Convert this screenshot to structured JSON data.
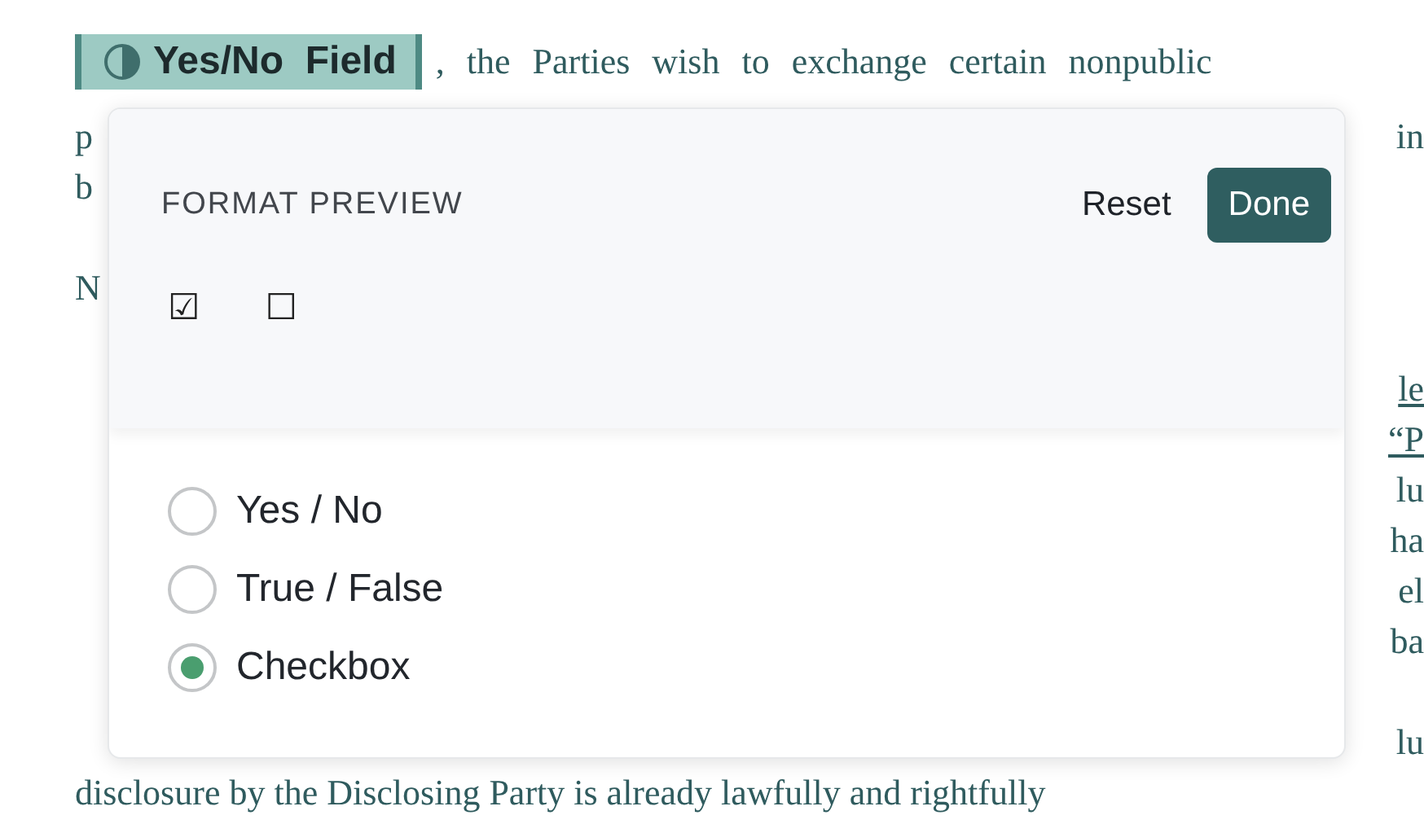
{
  "document": {
    "field": {
      "label": "Yes/No  Field"
    },
    "lines": [
      {
        "kind": "text",
        "left": ", the Parties wish to exchange certain nonpublic"
      },
      {
        "kind": "text",
        "left": "p",
        "right": "in"
      },
      {
        "kind": "text",
        "left": "b"
      },
      {
        "kind": "blank"
      },
      {
        "kind": "text",
        "left": "N"
      },
      {
        "kind": "blank"
      },
      {
        "kind": "text",
        "right": "le",
        "underlined": true
      },
      {
        "kind": "text",
        "right": "“P",
        "underlined": true
      },
      {
        "kind": "text",
        "right": "lu"
      },
      {
        "kind": "text",
        "right": "ha"
      },
      {
        "kind": "text",
        "right": "el"
      },
      {
        "kind": "text",
        "right": "ba"
      },
      {
        "kind": "blank"
      },
      {
        "kind": "text",
        "right": "lu"
      },
      {
        "kind": "text",
        "left": "disclosure by the Disclosing Party is already lawfully and rightfully"
      }
    ]
  },
  "popover": {
    "title": "FORMAT PREVIEW",
    "reset": "Reset",
    "done": "Done",
    "preview": [
      "☑",
      "☐"
    ],
    "options": [
      {
        "label": "Yes / No",
        "selected": false
      },
      {
        "label": "True / False",
        "selected": false
      },
      {
        "label": "Checkbox",
        "selected": true
      }
    ]
  }
}
